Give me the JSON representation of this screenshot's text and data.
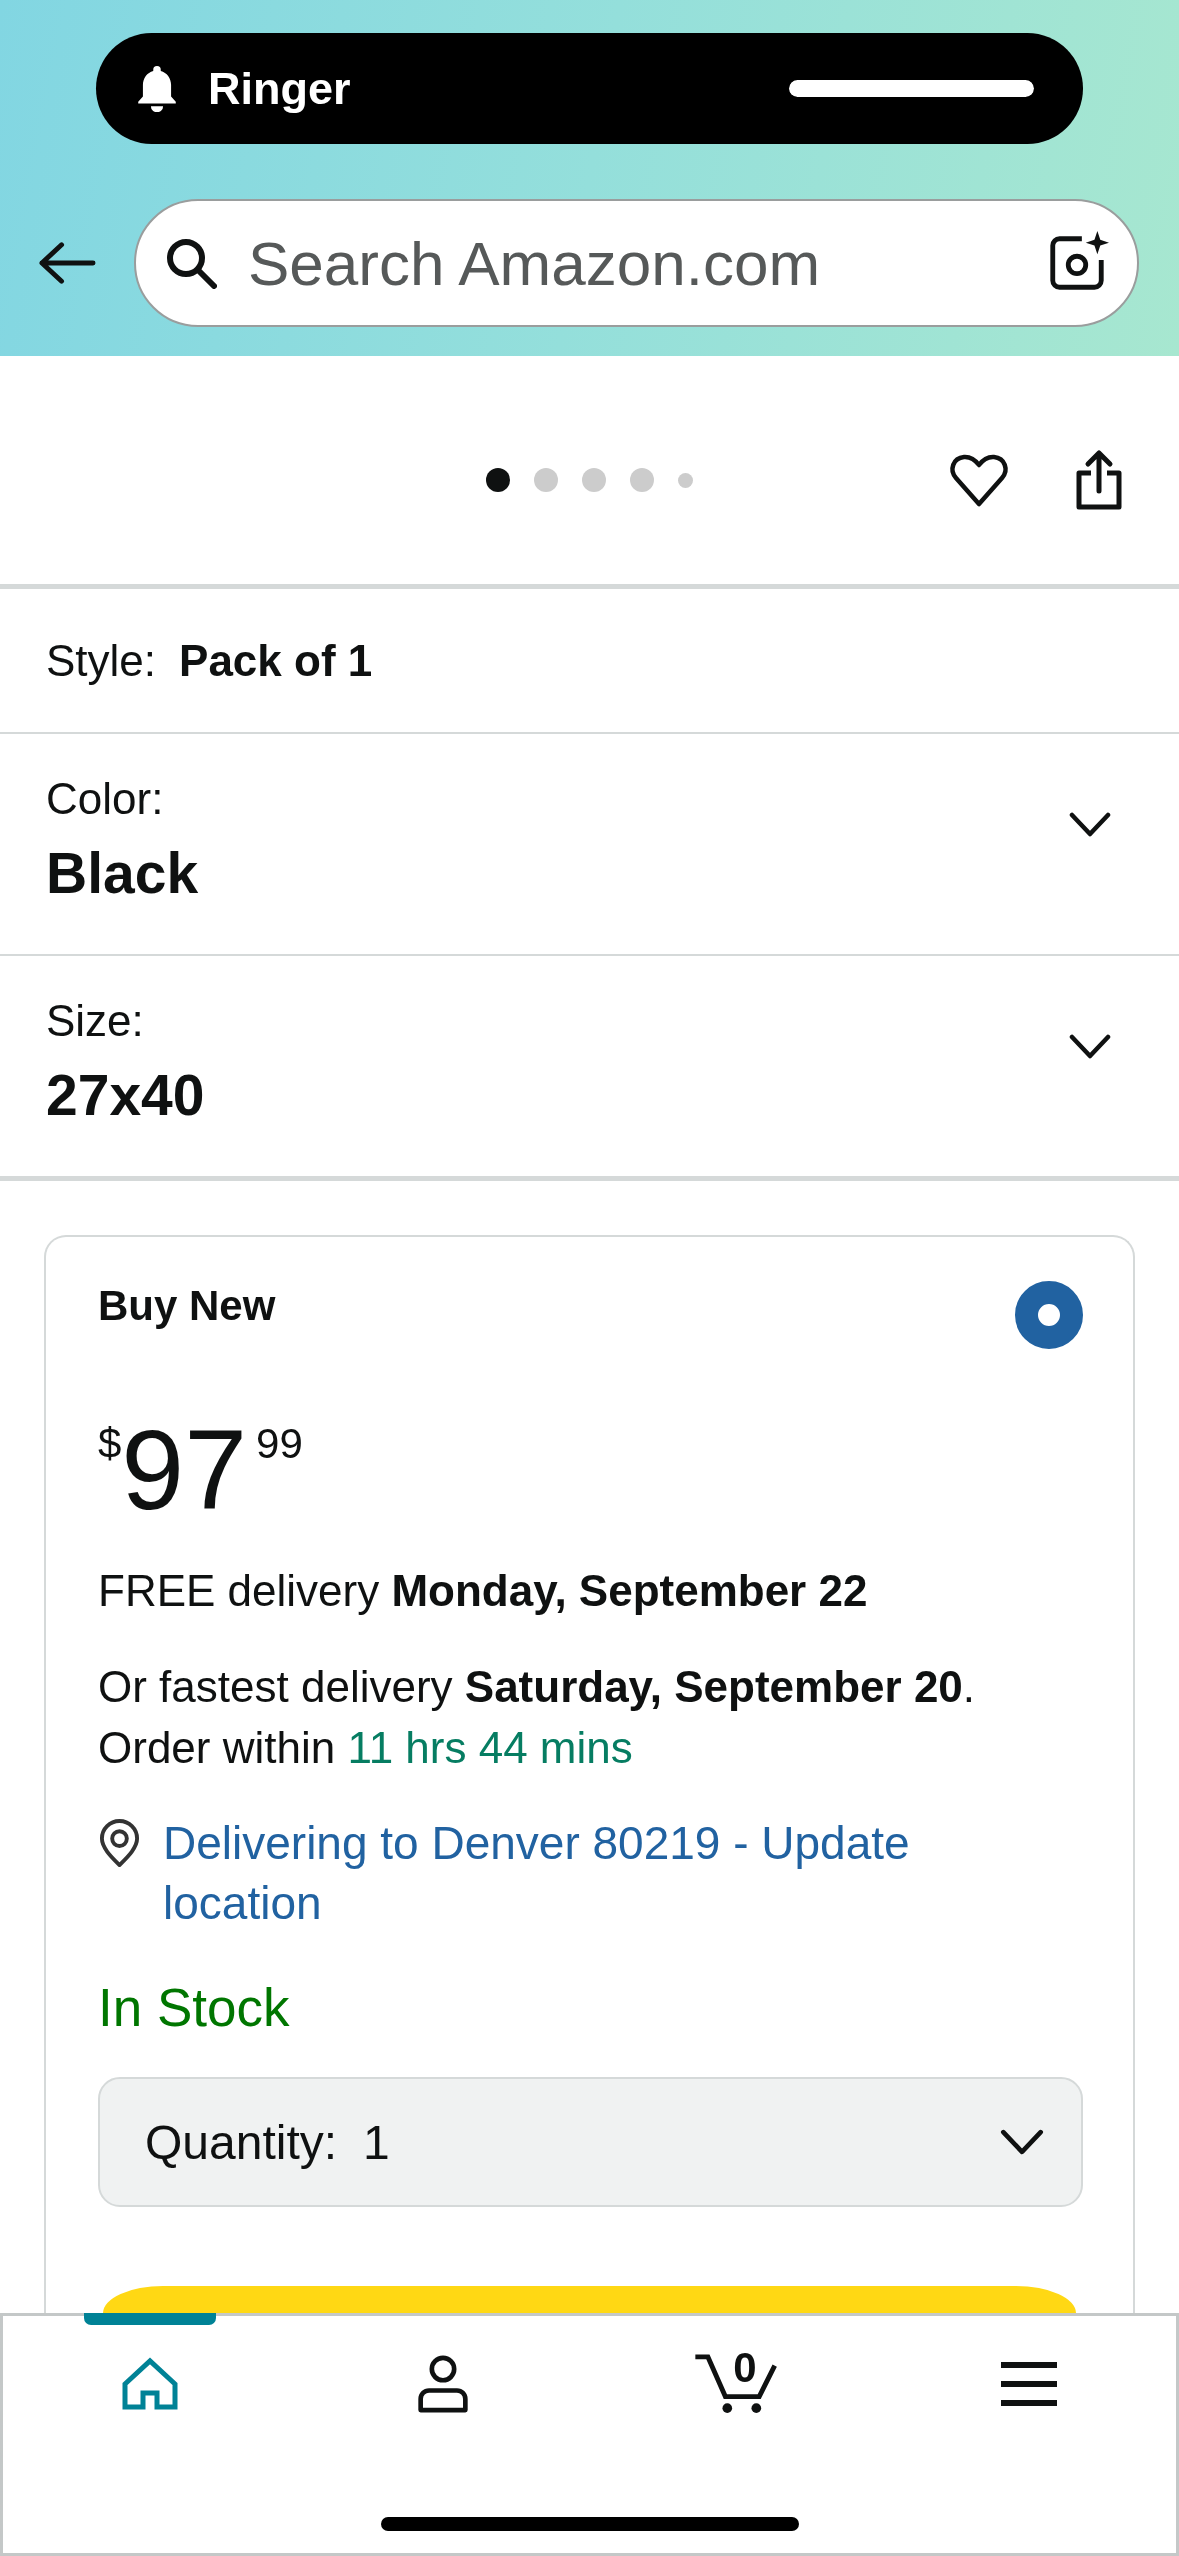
{
  "ringer": {
    "label": "Ringer",
    "level": 1
  },
  "search": {
    "placeholder": "Search Amazon.com"
  },
  "carousel": {
    "dots": [
      {
        "kind": "page",
        "selected": true
      },
      {
        "kind": "page",
        "selected": false
      },
      {
        "kind": "page",
        "selected": false
      },
      {
        "kind": "page",
        "selected": false
      },
      {
        "kind": "more",
        "selected": false
      }
    ]
  },
  "variations": [
    {
      "kind": "inline",
      "label": "Style:",
      "value": "Pack of 1"
    },
    {
      "kind": "dropdown",
      "label": "Color:",
      "value": "Black"
    },
    {
      "kind": "dropdown",
      "label": "Size:",
      "value": "27x40"
    }
  ],
  "buy_box": {
    "title": "Buy New",
    "selected": true,
    "price": {
      "currency": "$",
      "whole": "97",
      "fraction": "99"
    },
    "delivery": "FREE delivery **Monday, September 22**",
    "fastest_delivery": {
      "text": "Or fastest delivery **Saturday, September 20**. Order within",
      "countdown": "11 hrs 44 mins"
    },
    "location_link": "Delivering to Denver 80219 - Update location",
    "stock": "In Stock",
    "quantity": {
      "label": "Quantity:",
      "value": "1"
    }
  },
  "nav": {
    "items": [
      {
        "kind": "home",
        "selected": true
      },
      {
        "kind": "account",
        "selected": false
      },
      {
        "kind": "cart",
        "selected": false,
        "count": "0"
      },
      {
        "kind": "menu",
        "selected": false
      }
    ]
  }
}
